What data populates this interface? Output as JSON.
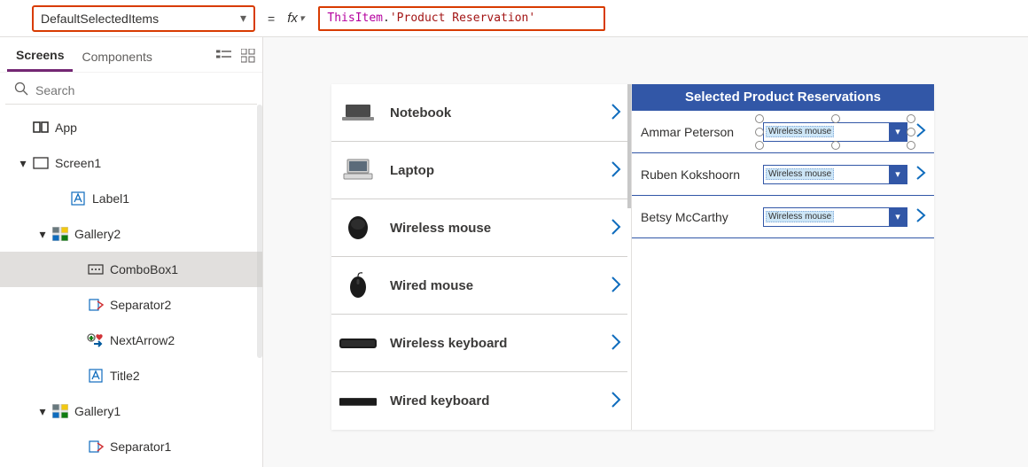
{
  "formula": {
    "property": "DefaultSelectedItems",
    "equals": "=",
    "fx": "fx",
    "token_this": "ThisItem",
    "token_dot": ".",
    "token_string": "'Product Reservation'"
  },
  "tabs": {
    "screens": "Screens",
    "components": "Components"
  },
  "search": {
    "placeholder": "Search"
  },
  "tree": {
    "app": "App",
    "screen1": "Screen1",
    "label1": "Label1",
    "gallery2": "Gallery2",
    "combobox1": "ComboBox1",
    "separator2": "Separator2",
    "nextarrow2": "NextArrow2",
    "title2": "Title2",
    "gallery1": "Gallery1",
    "separator1": "Separator1"
  },
  "products": [
    {
      "name": "Notebook",
      "thumb": "laptop-closed"
    },
    {
      "name": "Laptop",
      "thumb": "laptop-open"
    },
    {
      "name": "Wireless mouse",
      "thumb": "mouse"
    },
    {
      "name": "Wired mouse",
      "thumb": "mouse-wired"
    },
    {
      "name": "Wireless keyboard",
      "thumb": "keyboard"
    },
    {
      "name": "Wired keyboard",
      "thumb": "keyboard-thin"
    }
  ],
  "reservations": {
    "title": "Selected Product Reservations",
    "rows": [
      {
        "name": "Ammar Peterson",
        "selection": "Wireless mouse",
        "isSelected": true
      },
      {
        "name": "Ruben Kokshoorn",
        "selection": "Wireless mouse",
        "isSelected": false
      },
      {
        "name": "Betsy McCarthy",
        "selection": "Wireless mouse",
        "isSelected": false
      }
    ]
  },
  "colors": {
    "accent": "#3257a7",
    "purple": "#742774",
    "alert_border": "#d83b01"
  }
}
